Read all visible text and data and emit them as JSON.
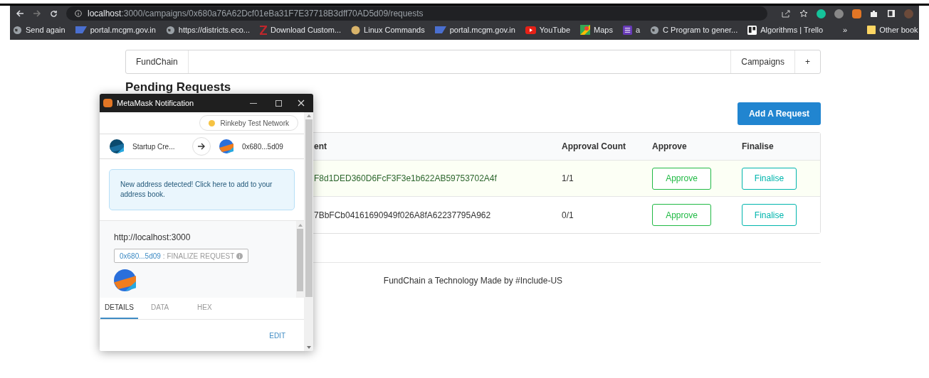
{
  "browser": {
    "url_host": "localhost",
    "url_path": ":3000/campaigns/0x680a76A62Dcf01eBa31F7E37718B3dff70AD5d09/requests",
    "bookmarks": [
      {
        "label": "Send again",
        "kind": "globe"
      },
      {
        "label": "portal.mcgm.gov.in",
        "kind": "sap"
      },
      {
        "label": "https://districts.eco...",
        "kind": "globe"
      },
      {
        "label": "Download Custom...",
        "kind": "z"
      },
      {
        "label": "Linux Commands",
        "kind": "ball"
      },
      {
        "label": "portal.mcgm.gov.in",
        "kind": "sap"
      },
      {
        "label": "YouTube",
        "kind": "youtube"
      },
      {
        "label": "Maps",
        "kind": "maps"
      },
      {
        "label": "a",
        "kind": "forms"
      },
      {
        "label": "C Program to gener...",
        "kind": "globe"
      },
      {
        "label": "Algorithms | Trello",
        "kind": "trello"
      }
    ],
    "overflow": "»",
    "other": "Other book"
  },
  "nav": {
    "brand": "FundChain",
    "items": [
      "Campaigns",
      "+"
    ]
  },
  "heading": "Pending Requests",
  "add_button": "Add A Request",
  "table": {
    "columns": [
      "ent",
      "Approval Count",
      "Approve",
      "Finalise"
    ],
    "rows": [
      {
        "recipient": "F8d1DED360D6FcF3F3e1b622AB59753702A4f",
        "count": "1/1",
        "approve": "Approve",
        "finalise": "Finalise",
        "selected": true
      },
      {
        "recipient": "7BbFCb04161690949f026A8fA62237795A962",
        "count": "0/1",
        "approve": "Approve",
        "finalise": "Finalise",
        "selected": false
      }
    ]
  },
  "footer": "FundChain a Technology Made by #Include-US",
  "popup": {
    "title": "MetaMask Notification",
    "network": "Rinkeby Test Network",
    "from": "Startup Cre...",
    "to": "0x680...5d09",
    "notice": "New address detected! Click here to add to your address book.",
    "origin": "http://localhost:3000",
    "contract": "0x680...5d09",
    "method": ": FINALIZE REQUEST",
    "tabs": [
      {
        "label": "DETAILS",
        "selected": true
      },
      {
        "label": "DATA",
        "selected": false
      },
      {
        "label": "HEX",
        "selected": false
      }
    ],
    "edit": "EDIT"
  }
}
